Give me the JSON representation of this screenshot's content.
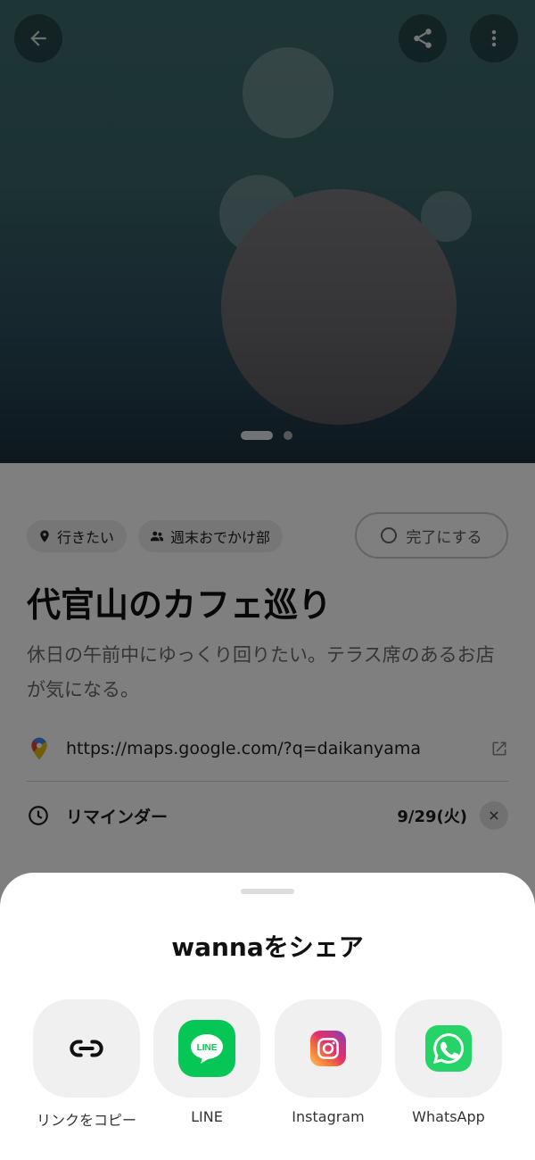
{
  "header": {
    "back_icon": "arrow-left-icon",
    "share_icon": "share-icon",
    "more_icon": "more-vertical-icon",
    "carousel": {
      "page_count": 2,
      "active_index": 0
    }
  },
  "item": {
    "status_chip": {
      "icon": "map-pin-icon",
      "label": "行きたい"
    },
    "group_chip": {
      "icon": "people-icon",
      "label": "週末おでかけ部"
    },
    "complete_button": {
      "icon": "circle-outline-icon",
      "label": "完了にする"
    },
    "title": "代官山のカフェ巡り",
    "description": "休日の午前中にゆっくり回りたい。テラス席のあるお店が気になる。",
    "map_link": {
      "icon": "google-maps-icon",
      "url": "https://maps.google.com/?q=daikanyama",
      "external_icon": "external-link-icon"
    },
    "reminder": {
      "icon": "clock-icon",
      "label": "リマインダー",
      "date": "9/29(火)",
      "clear_icon": "close-icon"
    }
  },
  "share_sheet": {
    "title": "wannaをシェア",
    "options": [
      {
        "icon": "link-icon",
        "label": "リンクをコピー"
      },
      {
        "icon": "line-icon",
        "label": "LINE",
        "badge_text": "LINE"
      },
      {
        "icon": "instagram-icon",
        "label": "Instagram"
      },
      {
        "icon": "whatsapp-icon",
        "label": "WhatsApp"
      }
    ]
  },
  "colors": {
    "line_green": "#06c755",
    "whatsapp_green": "#25d366",
    "scrim": "rgba(0,0,0,0.5)"
  }
}
